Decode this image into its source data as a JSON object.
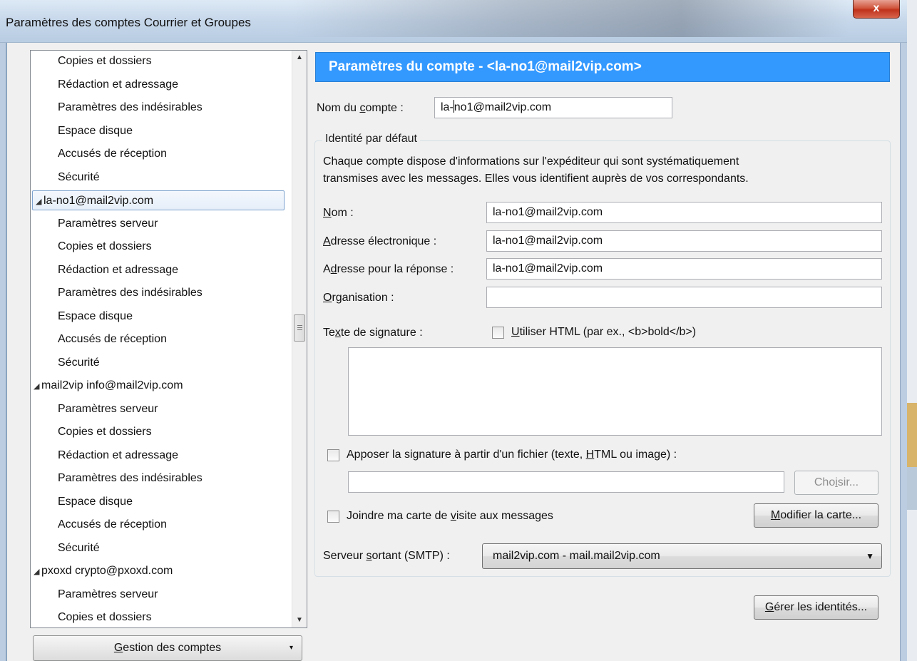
{
  "window": {
    "title": "Paramètres des comptes Courrier et Groupes",
    "close_label": "x"
  },
  "tree": {
    "items": [
      {
        "label": "Copies et dossiers",
        "level": "child"
      },
      {
        "label": "Rédaction et adressage",
        "level": "child"
      },
      {
        "label": "Paramètres des indésirables",
        "level": "child"
      },
      {
        "label": "Espace disque",
        "level": "child"
      },
      {
        "label": "Accusés de réception",
        "level": "child"
      },
      {
        "label": "Sécurité",
        "level": "child"
      },
      {
        "label": "la-no1@mail2vip.com",
        "level": "account",
        "selected": true
      },
      {
        "label": "Paramètres serveur",
        "level": "child"
      },
      {
        "label": "Copies et dossiers",
        "level": "child"
      },
      {
        "label": "Rédaction et adressage",
        "level": "child"
      },
      {
        "label": "Paramètres des indésirables",
        "level": "child"
      },
      {
        "label": "Espace disque",
        "level": "child"
      },
      {
        "label": "Accusés de réception",
        "level": "child"
      },
      {
        "label": "Sécurité",
        "level": "child"
      },
      {
        "label": "mail2vip info@mail2vip.com",
        "level": "account"
      },
      {
        "label": "Paramètres serveur",
        "level": "child"
      },
      {
        "label": "Copies et dossiers",
        "level": "child"
      },
      {
        "label": "Rédaction et adressage",
        "level": "child"
      },
      {
        "label": "Paramètres des indésirables",
        "level": "child"
      },
      {
        "label": "Espace disque",
        "level": "child"
      },
      {
        "label": "Accusés de réception",
        "level": "child"
      },
      {
        "label": "Sécurité",
        "level": "child"
      },
      {
        "label": "pxoxd crypto@pxoxd.com",
        "level": "account"
      },
      {
        "label": "Paramètres serveur",
        "level": "child"
      },
      {
        "label": "Copies et dossiers",
        "level": "child"
      }
    ],
    "twisty": "◢",
    "manage_button": {
      "pre": "",
      "underline": "G",
      "post": "estion des comptes",
      "caret": "▾"
    }
  },
  "panel": {
    "header": "Paramètres du compte - <la-no1@mail2vip.com>",
    "account_name": {
      "pre": "Nom du ",
      "underline": "c",
      "post": "ompte :",
      "value_before_cursor": "la-",
      "value_after_cursor": "no1@mail2vip.com"
    },
    "identity_group_title": "Identité par défaut",
    "identity_desc_line1": "Chaque compte dispose d'informations sur l'expéditeur qui sont systématiquement",
    "identity_desc_line2": "transmises avec les messages. Elles vous identifient auprès de vos correspondants.",
    "name": {
      "underline": "N",
      "post": "om :",
      "value": "la-no1@mail2vip.com"
    },
    "email": {
      "underline": "A",
      "post": "dresse électronique :",
      "value": "la-no1@mail2vip.com"
    },
    "reply_to": {
      "pre": "A",
      "underline": "d",
      "post": "resse pour la réponse :",
      "value": "la-no1@mail2vip.com"
    },
    "organization": {
      "underline": "O",
      "post": "rganisation :",
      "value": ""
    },
    "signature_label": {
      "pre": "Te",
      "underline": "x",
      "post": "te de signature :"
    },
    "use_html": {
      "underline": "U",
      "post": "tiliser HTML (par ex., <b>bold</b>)",
      "checked": false
    },
    "sig_from_file": {
      "pre": "Apposer la signature à partir d'un fichier (texte, ",
      "underline": "H",
      "post": "TML ou image) :",
      "checked": false
    },
    "sig_file_path": "",
    "choose_button": {
      "pre": "Cho",
      "underline": "i",
      "post": "sir..."
    },
    "attach_vcard": {
      "pre": "Joindre ma carte de ",
      "underline": "v",
      "post": "isite aux messages",
      "checked": false
    },
    "edit_card_button": {
      "underline": "M",
      "post": "odifier la carte..."
    },
    "smtp": {
      "pre": "Serveur ",
      "underline": "s",
      "post": "ortant (SMTP) :",
      "value": "mail2vip.com - mail.mail2vip.com",
      "caret": "▼"
    },
    "manage_identities_button": {
      "underline": "G",
      "post": "érer les identités..."
    }
  }
}
